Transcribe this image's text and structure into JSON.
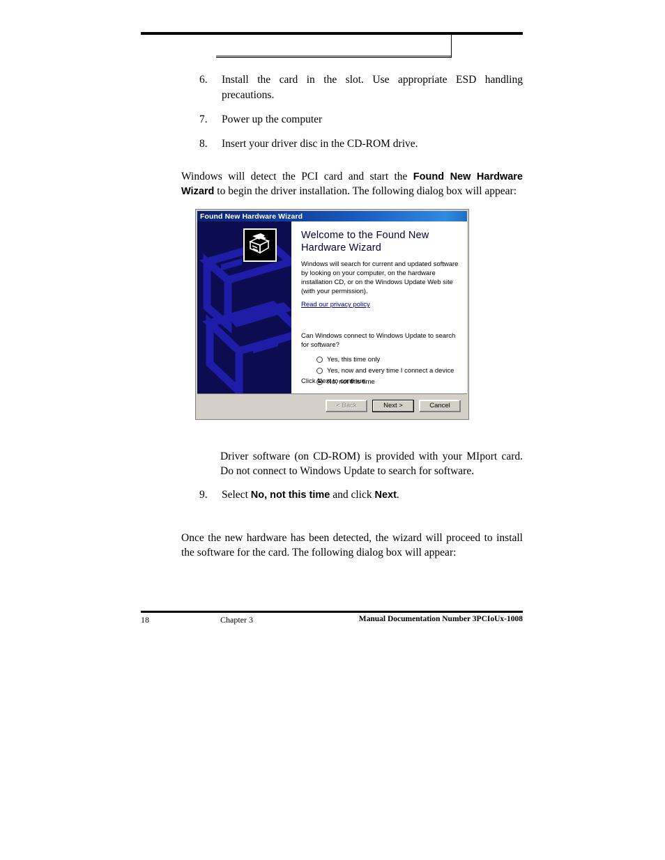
{
  "header": {
    "title": ""
  },
  "steps_top": [
    {
      "num": "6.",
      "text": "Install the card in the slot. Use appropriate ESD handling precautions.",
      "justify": true
    },
    {
      "num": "7.",
      "text": "Power up the computer",
      "justify": false
    },
    {
      "num": "8.",
      "text": "Insert your driver disc in the CD-ROM drive.",
      "justify": false
    }
  ],
  "paragraphs": {
    "intro_part1": "Windows will detect the PCI card and start the ",
    "intro_bold1": "Found New Hardware Wizard",
    "intro_part2": " to begin the driver installation. The following dialog box will appear:",
    "note": "Driver software (on CD-ROM) is provided with your MIport card. Do not connect to Windows Update to search for software.",
    "outro": "Once the new hardware has been detected, the wizard will proceed to install the software for the card. The following dialog box will appear:"
  },
  "step9": {
    "num": "9.",
    "part1": "Select ",
    "bold1": "No, not this time",
    "part2": " and click ",
    "bold2": "Next",
    "part3": "."
  },
  "dialog": {
    "titlebar": "Found New Hardware Wizard",
    "heading_line1": "Welcome to the Found New",
    "heading_line2": "Hardware Wizard",
    "body_text": "Windows will search for current and updated software by looking on your computer, on the hardware installation CD, or on the Windows Update Web site (with your permission).",
    "privacy_link": "Read our privacy policy",
    "question": "Can Windows connect to Windows Update to search for software?",
    "radio_options": [
      {
        "label": "Yes, this time only",
        "checked": false
      },
      {
        "label": "Yes, now and every time I connect a device",
        "checked": false
      },
      {
        "label": "No, not this time",
        "checked": true
      }
    ],
    "footer_hint": "Click Next to continue.",
    "buttons": [
      {
        "label": "< Back",
        "state": "disabled"
      },
      {
        "label": "Next >",
        "state": "default"
      },
      {
        "label": "Cancel",
        "state": "normal"
      }
    ],
    "colors": {
      "titlebar_start": "#0a246a",
      "titlebar_end": "#2f8ae0",
      "wizard_panel_bg": "#0c0c50",
      "wizard_art": "#1a1a9e",
      "dialog_face": "#d4d0c8",
      "link": "#00007f",
      "heading": "#00003a"
    }
  },
  "footer": {
    "page_number": "18",
    "chapter": "Chapter 3",
    "doc_number": "Manual Documentation Number 3PCIoUx-1008"
  }
}
